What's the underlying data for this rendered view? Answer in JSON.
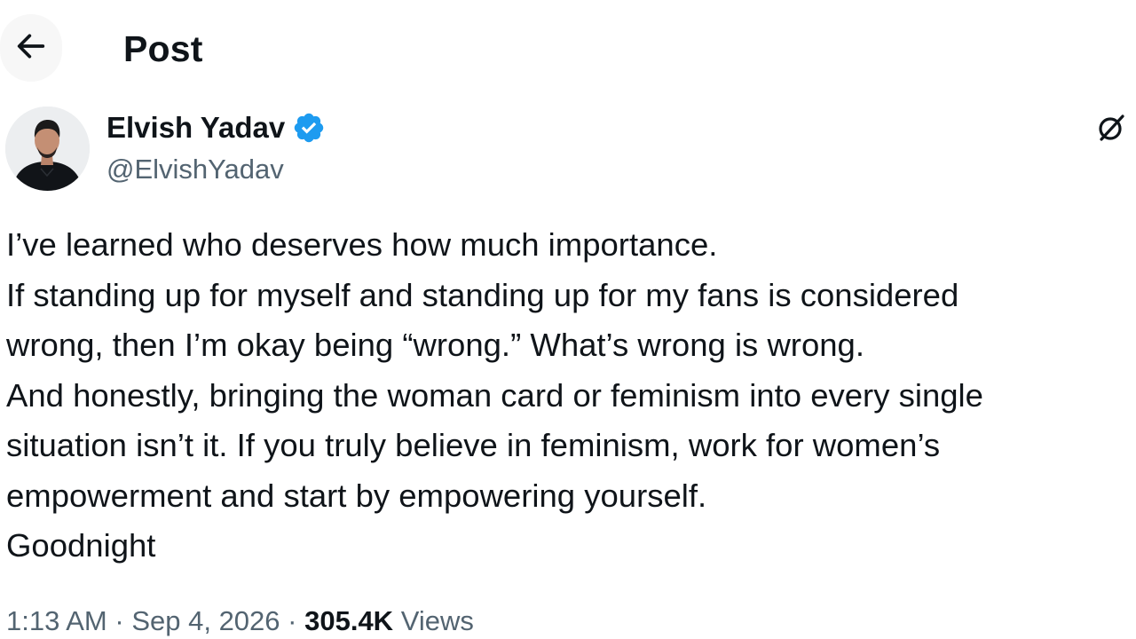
{
  "header": {
    "title": "Post",
    "back_icon": "arrow-left-icon"
  },
  "author": {
    "display_name": "Elvish Yadav",
    "handle": "@ElvishYadav",
    "verified_icon": "verified-badge-icon",
    "verified_color": "#1d9bf0"
  },
  "actions": {
    "grok_icon": "grok-icon"
  },
  "tweet": {
    "lines": [
      "I’ve learned who deserves how much importance.",
      "If standing up for myself and standing up for my fans is considered",
      "wrong, then I’m okay being “wrong.” What’s wrong is wrong.",
      "And honestly, bringing the woman card or feminism into every single",
      "situation isn’t it. If you truly believe in feminism, work for women’s",
      "empowerment and start by empowering yourself.",
      "Goodnight"
    ]
  },
  "meta": {
    "time": "1:13 AM",
    "separator": "·",
    "date": "Sep 4, 2026",
    "views_count": "305.4K",
    "views_label": "Views"
  },
  "colors": {
    "text": "#0f1419",
    "secondary": "#536471",
    "background": "#ffffff"
  }
}
